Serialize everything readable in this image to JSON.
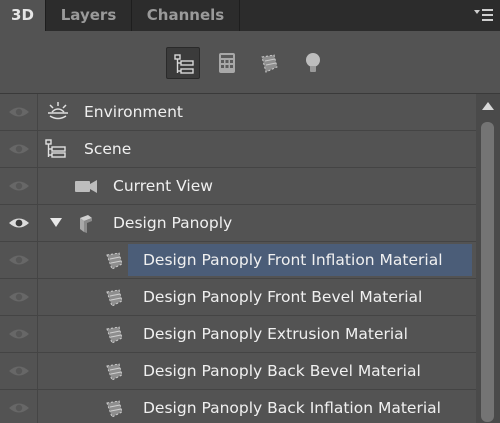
{
  "tabs": [
    {
      "label": "3D",
      "active": true
    },
    {
      "label": "Layers",
      "active": false
    },
    {
      "label": "Channels",
      "active": false
    }
  ],
  "toolbar": {
    "filters": [
      {
        "icon": "scene-filter-icon",
        "active": true
      },
      {
        "icon": "mesh-filter-icon",
        "active": false
      },
      {
        "icon": "material-filter-icon",
        "active": false
      },
      {
        "icon": "light-filter-icon",
        "active": false
      }
    ]
  },
  "items": [
    {
      "label": "Environment",
      "icon": "environment-icon",
      "visible": false
    },
    {
      "label": "Scene",
      "icon": "scene-icon",
      "visible": false
    },
    {
      "label": "Current View",
      "icon": "camera-icon",
      "visible": false
    },
    {
      "label": "Design Panoply",
      "icon": "mesh-icon",
      "visible": true,
      "expanded": true
    },
    {
      "label": "Design Panoply Front Inflation Material",
      "icon": "material-icon",
      "visible": false,
      "selected": true
    },
    {
      "label": "Design Panoply Front Bevel Material",
      "icon": "material-icon",
      "visible": false
    },
    {
      "label": "Design Panoply Extrusion Material",
      "icon": "material-icon",
      "visible": false
    },
    {
      "label": "Design Panoply Back Bevel Material",
      "icon": "material-icon",
      "visible": false
    },
    {
      "label": "Design Panoply Back Inflation Material",
      "icon": "material-icon",
      "visible": false
    }
  ],
  "colors": {
    "panel_bg": "#535353",
    "tab_bar_bg": "#2c2c2c",
    "selection": "#4b5d78",
    "text": "#f0f0f0"
  }
}
